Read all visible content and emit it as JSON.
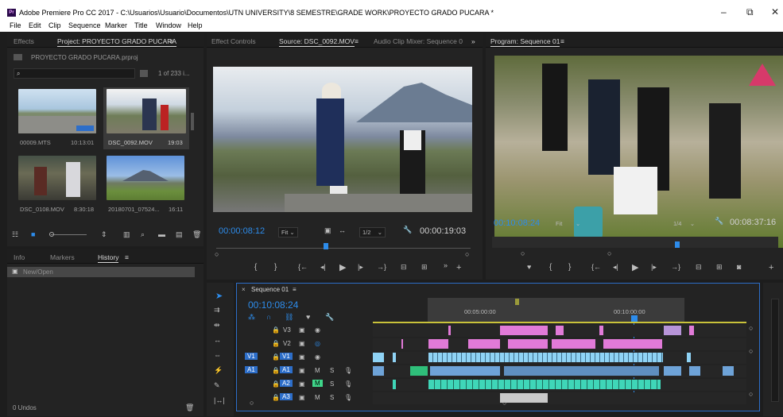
{
  "window": {
    "title": "Adobe Premiere Pro CC 2017 - C:\\Usuarios\\Usuario\\Documentos\\UTN UNIVERSITY\\8 SEMESTRE\\GRADE WORK\\PROYECTO GRADO PUCARA *",
    "logo_text": "Pr",
    "minimize": "–",
    "restore": "⧉",
    "close": "✕"
  },
  "menu": [
    "File",
    "Edit",
    "Clip",
    "Sequence",
    "Marker",
    "Title",
    "Window",
    "Help"
  ],
  "project_panel": {
    "tabs": [
      "Effects",
      "Project: PROYECTO GRADO PUCARA",
      "≡"
    ],
    "project_file": "PROYECTO GRADO PUCARA.prproj",
    "item_count": "1 of 233 i...",
    "clips": [
      {
        "name": "00009.MTS",
        "duration": "10:13:01"
      },
      {
        "name": "DSC_0092.MOV",
        "duration": "19:03"
      },
      {
        "name": "DSC_0108.MOV",
        "duration": "8:30:18"
      },
      {
        "name": "20180701_07524...",
        "duration": "16:11"
      }
    ]
  },
  "history_panel": {
    "tabs": [
      "Info",
      "Markers",
      "History",
      "≡"
    ],
    "items": [
      "New/Open"
    ],
    "undos": "0 Undos"
  },
  "source_panel": {
    "tabs": [
      "Effect Controls",
      "Source: DSC_0092.MOV",
      "≡",
      "Audio Clip Mixer: Sequence 0",
      "»"
    ],
    "timecode": "00:00:08:12",
    "fit": "Fit",
    "resolution": "1/2",
    "duration": "00:00:19:03"
  },
  "program_panel": {
    "tab": "Program: Sequence 01",
    "menu_icon": "≡",
    "timecode": "00:10:08:24",
    "fit": "Fit",
    "resolution": "1/4",
    "duration": "00:08:37:16"
  },
  "timeline": {
    "tab": "Sequence 01",
    "menu_icon": "≡",
    "close": "×",
    "timecode": "00:10:08:24",
    "ruler": [
      "00:05:00:00",
      "00:10:00:00"
    ],
    "tracks": [
      {
        "target": "",
        "toggle": "",
        "name": "V3"
      },
      {
        "target": "",
        "toggle": "",
        "name": "V2"
      },
      {
        "target": "V1",
        "toggle": "",
        "name": "V1"
      },
      {
        "target": "A1",
        "toggle": "",
        "name": "A1",
        "m": "M",
        "s": "S"
      },
      {
        "target": "",
        "toggle": "",
        "name": "A2",
        "m": "M",
        "s": "S"
      },
      {
        "target": "",
        "toggle": "",
        "name": "A3",
        "m": "M",
        "s": "S"
      }
    ]
  },
  "colors": {
    "accent": "#2d8ceb",
    "video_clip": "#8fd3f5",
    "title_clip": "#e17ad8",
    "audio_clip": "#3fd6b8",
    "green_clip": "#2fbf7a"
  }
}
